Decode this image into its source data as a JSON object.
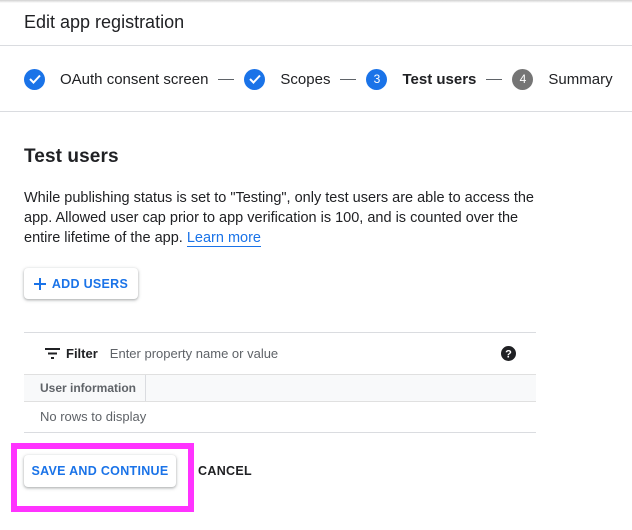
{
  "header": {
    "title": "Edit app registration"
  },
  "stepper": {
    "steps": [
      {
        "number": "1",
        "label": "OAuth consent screen",
        "state": "complete"
      },
      {
        "number": "2",
        "label": "Scopes",
        "state": "complete"
      },
      {
        "number": "3",
        "label": "Test users",
        "state": "active"
      },
      {
        "number": "4",
        "label": "Summary",
        "state": "upcoming"
      }
    ]
  },
  "main": {
    "section_title": "Test users",
    "description": "While publishing status is set to \"Testing\", only test users are able to access the app. Allowed user cap prior to app verification is 100, and is counted over the entire lifetime of the app.",
    "learn_more": "Learn more",
    "add_users_label": "ADD USERS"
  },
  "table": {
    "filter_label": "Filter",
    "filter_value": "",
    "filter_placeholder": "Enter property name or value",
    "columns": [
      "User information"
    ],
    "rows": [],
    "empty_message": "No rows to display"
  },
  "actions": {
    "save_label": "SAVE AND CONTINUE",
    "cancel_label": "CANCEL"
  },
  "colors": {
    "accent": "#1a73e8",
    "highlight": "#ff33ff",
    "upcoming_step": "#757575"
  }
}
